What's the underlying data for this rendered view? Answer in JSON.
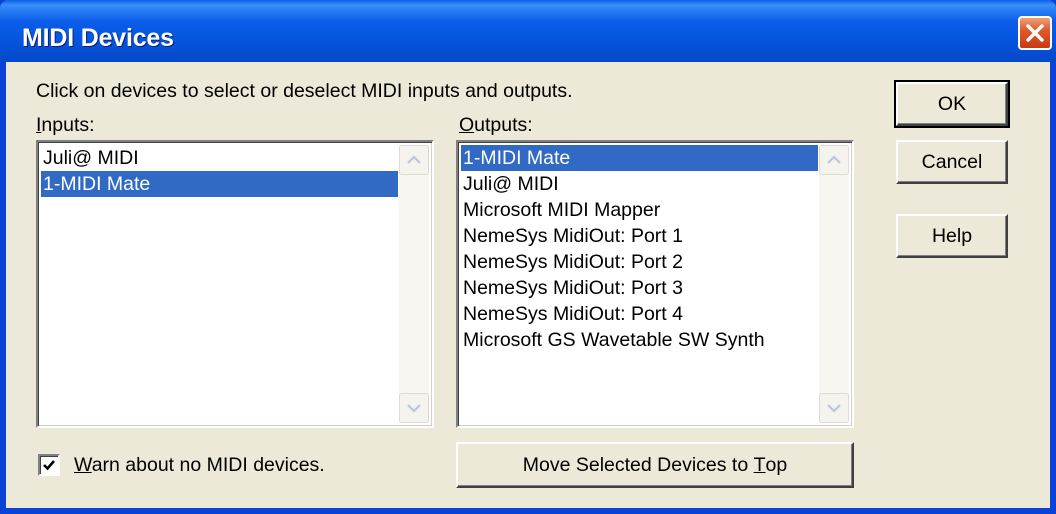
{
  "window": {
    "title": "MIDI Devices"
  },
  "instructions": "Click on devices to select or deselect MIDI inputs and outputs.",
  "inputs": {
    "label_key": "I",
    "label_rest": "nputs:",
    "items": [
      {
        "label": "Juli@ MIDI",
        "selected": false
      },
      {
        "label": "1-MIDI Mate",
        "selected": true
      }
    ]
  },
  "outputs": {
    "label_key": "O",
    "label_rest": "utputs:",
    "items": [
      {
        "label": "1-MIDI Mate",
        "selected": true
      },
      {
        "label": "Juli@ MIDI",
        "selected": false
      },
      {
        "label": "Microsoft MIDI Mapper",
        "selected": false
      },
      {
        "label": "NemeSys MidiOut: Port 1",
        "selected": false
      },
      {
        "label": "NemeSys MidiOut: Port 2",
        "selected": false
      },
      {
        "label": "NemeSys MidiOut: Port 3",
        "selected": false
      },
      {
        "label": "NemeSys MidiOut: Port 4",
        "selected": false
      },
      {
        "label": "Microsoft GS Wavetable SW Synth",
        "selected": false
      }
    ]
  },
  "buttons": {
    "ok": "OK",
    "cancel": "Cancel",
    "help": "Help",
    "move_pre": "Move Selected Devices to ",
    "move_key": "T",
    "move_post": "op"
  },
  "warn": {
    "checked": true,
    "label_key": "W",
    "label_rest": "arn about no MIDI devices."
  },
  "colors": {
    "title_bar": "#0553dc",
    "selection": "#316ac5",
    "close_button": "#e15a2c",
    "dialog_face": "#ece9d8"
  },
  "icons": {
    "close": "close-icon",
    "scroll_up": "chevron-up-icon",
    "scroll_down": "chevron-down-icon",
    "check": "checkmark-icon"
  }
}
